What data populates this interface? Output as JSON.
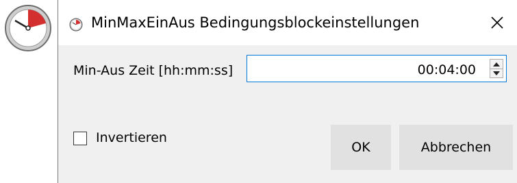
{
  "app_icon": {
    "icon": "gauge-icon",
    "accent_color": "#d32f2f"
  },
  "dialog": {
    "title": "MinMaxEinAus Bedingungsblockeinstellungen",
    "title_icon": "gauge-icon",
    "close_icon": "close-icon",
    "min_off_time": {
      "label": "Min-Aus Zeit [hh:mm:ss]",
      "value": "00:04:00"
    },
    "invert": {
      "label": "Invertieren",
      "checked": false
    },
    "buttons": {
      "ok": "OK",
      "cancel": "Abbrechen"
    }
  },
  "colors": {
    "dialog_bg": "#f0f0f0",
    "titlebar_bg": "#ffffff",
    "input_focus_border": "#0078d7",
    "button_bg": "#e1e1e1"
  }
}
